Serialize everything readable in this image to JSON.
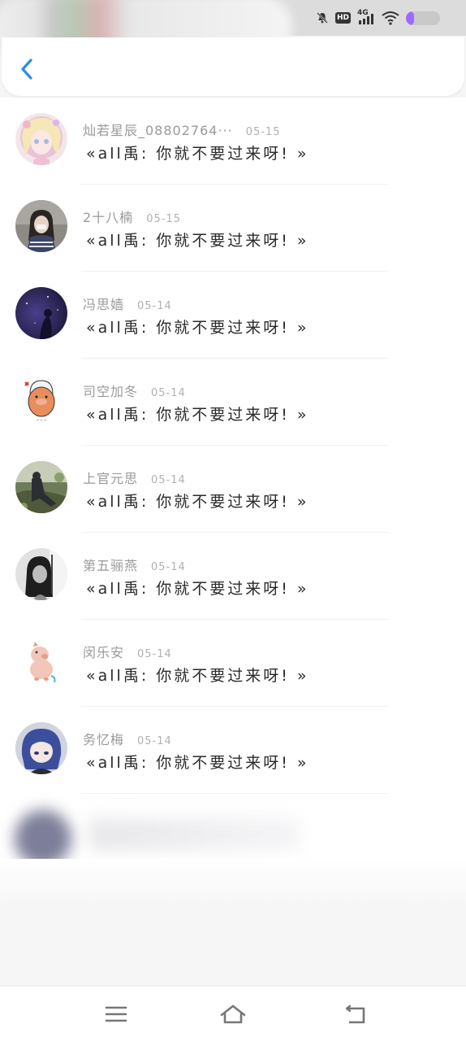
{
  "status_bar": {
    "network": "4G",
    "hd_label": "HD"
  },
  "header": {
    "back_icon": "chevron-left-icon",
    "accent_color": "#2b8ee8"
  },
  "messages": [
    {
      "name": "灿若星辰_08802764···",
      "date": "05-15",
      "text": "«all禹: 你就不要过来呀! »",
      "avatar": "anime-girl-avatar"
    },
    {
      "name": "2十八楠",
      "date": "05-15",
      "text": "«all禹: 你就不要过来呀! »",
      "avatar": "girl-photo-avatar"
    },
    {
      "name": "冯思嫱",
      "date": "05-14",
      "text": "«all禹: 你就不要过来呀! »",
      "avatar": "night-sky-avatar"
    },
    {
      "name": "司空加冬",
      "date": "05-14",
      "text": "«all禹: 你就不要过来呀! »",
      "avatar": "cartoon-sticker-avatar"
    },
    {
      "name": "上官元思",
      "date": "05-14",
      "text": "«all禹: 你就不要过来呀! »",
      "avatar": "outdoor-photo-avatar"
    },
    {
      "name": "第五骊燕",
      "date": "05-14",
      "text": "«all禹: 你就不要过来呀! »",
      "avatar": "bw-portrait-avatar"
    },
    {
      "name": "闵乐安",
      "date": "05-14",
      "text": "«all禹: 你就不要过来呀! »",
      "avatar": "cartoon-pig-avatar"
    },
    {
      "name": "务忆梅",
      "date": "05-14",
      "text": "«all禹: 你就不要过来呀! »",
      "avatar": "anime-blue-hair-avatar"
    }
  ],
  "nav_bar": {
    "menu_icon": "menu-icon",
    "home_icon": "home-icon",
    "back_icon": "back-arrow-icon"
  }
}
